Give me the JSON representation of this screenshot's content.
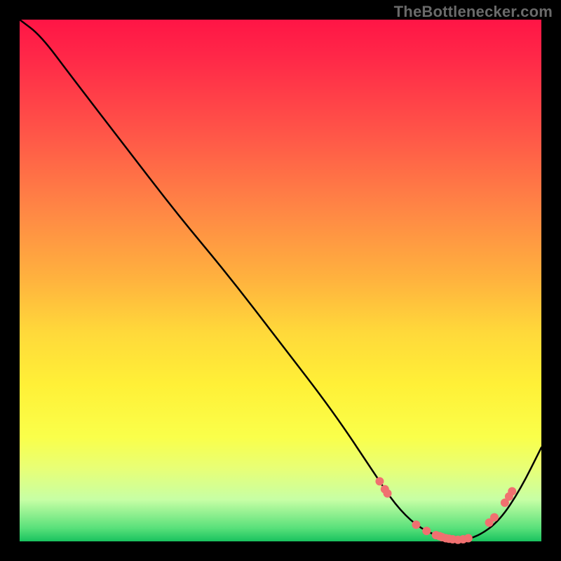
{
  "attribution": "TheBottlenecker.com",
  "chart_data": {
    "type": "line",
    "title": "",
    "xlabel": "",
    "ylabel": "",
    "xlim": [
      0,
      100
    ],
    "ylim": [
      0,
      100
    ],
    "x": [
      0,
      4,
      10,
      20,
      30,
      40,
      50,
      60,
      68,
      72,
      76,
      80,
      84,
      88,
      92,
      96,
      100
    ],
    "values": [
      100,
      97,
      89,
      76,
      63,
      51,
      38,
      25,
      13,
      7,
      3,
      1,
      0,
      1,
      4,
      10,
      18
    ],
    "markers_x": [
      69,
      70,
      70.5,
      76,
      78,
      79.8,
      80.5,
      81,
      81.7,
      82.3,
      83,
      84,
      85,
      86,
      90,
      91,
      93,
      93.8,
      94.4
    ],
    "markers_y": [
      11.5,
      10,
      9.2,
      3.2,
      2,
      1.2,
      1,
      0.8,
      0.6,
      0.5,
      0.4,
      0.3,
      0.4,
      0.6,
      3.6,
      4.6,
      7.4,
      8.6,
      9.6
    ]
  }
}
